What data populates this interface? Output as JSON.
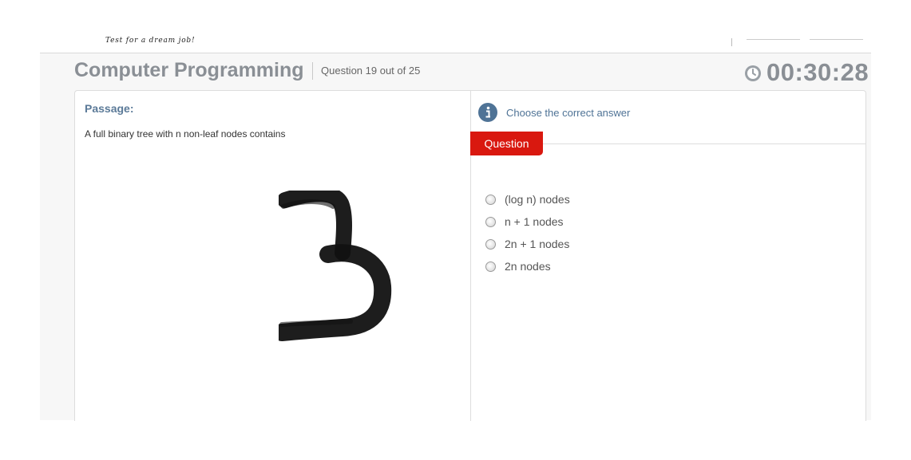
{
  "header": {
    "tagline": "Test for a dream job!"
  },
  "exam": {
    "subject": "Computer Programming",
    "question_counter": "Question 19 out of 25",
    "timer": "00:30:28"
  },
  "passage": {
    "label": "Passage:",
    "text": "A full binary tree with n non-leaf nodes contains",
    "annotation": "3"
  },
  "question_panel": {
    "instruction": "Choose the correct answer",
    "tab_label": "Question",
    "options": [
      {
        "label": "(log n) nodes",
        "selected": false
      },
      {
        "label": "n + 1 nodes",
        "selected": false
      },
      {
        "label": "2n + 1 nodes",
        "selected": false
      },
      {
        "label": "2n nodes",
        "selected": false
      }
    ]
  },
  "colors": {
    "accent_red": "#d9180f",
    "link_blue": "#4f7396",
    "title_gray": "#8a8f95"
  }
}
